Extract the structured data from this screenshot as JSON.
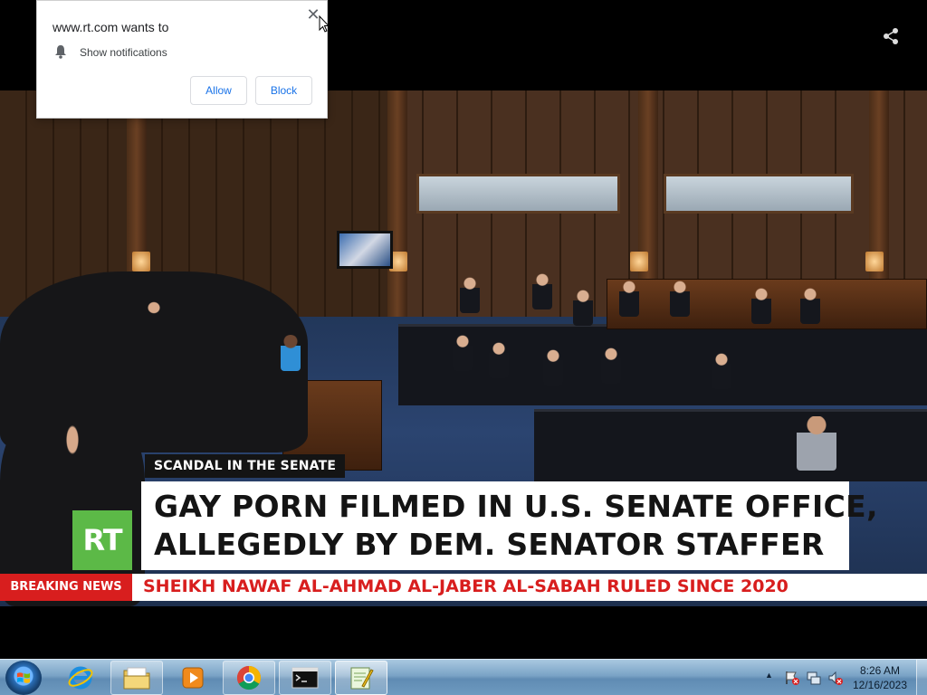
{
  "notification": {
    "site_prompt": "www.rt.com wants to",
    "permission": "Show notifications",
    "allow_label": "Allow",
    "block_label": "Block",
    "close_glyph": "✕"
  },
  "video": {
    "logo": "RT",
    "kicker": "SCANDAL IN THE SENATE",
    "headline_line1": "GAY PORN FILMED IN U.S. SENATE OFFICE,",
    "headline_line2": "ALLEGEDLY BY DEM. SENATOR STAFFER",
    "ticker_label": "BREAKING NEWS",
    "ticker_text": "SHEIKH NAWAF AL-AHMAD AL-JABER AL-SABAH RULED SINCE 2020",
    "share_icon": "share-icon"
  },
  "taskbar": {
    "items": [
      {
        "name": "internet-explorer",
        "icon": "ie-icon"
      },
      {
        "name": "file-explorer",
        "icon": "folder-icon"
      },
      {
        "name": "media-player",
        "icon": "media-player-icon"
      },
      {
        "name": "chrome",
        "icon": "chrome-icon"
      },
      {
        "name": "command-prompt",
        "icon": "cmd-icon"
      },
      {
        "name": "notepad-plus",
        "icon": "notepad-icon"
      }
    ],
    "clock_time": "8:26 AM",
    "clock_date": "12/16/2023"
  },
  "colors": {
    "rt_green": "#5cb947",
    "breaking_red": "#d81e1e",
    "link_blue": "#1a73e8"
  }
}
